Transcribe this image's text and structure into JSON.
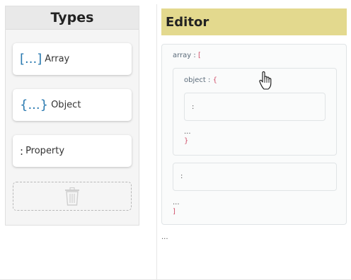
{
  "types_panel": {
    "title": "Types",
    "items": [
      {
        "symbol": "[...]",
        "label": "Array"
      },
      {
        "symbol": "{...}",
        "label": "Object"
      },
      {
        "symbol": ":",
        "label": "Property"
      }
    ],
    "trash_icon": "trash-icon"
  },
  "editor": {
    "title": "Editor",
    "array_node": {
      "key": "array",
      "sep": " : ",
      "open": "[",
      "close": "]",
      "ellipsis": "..."
    },
    "object_node": {
      "key": "object",
      "sep": " : ",
      "open": "{",
      "close": "}",
      "ellipsis": "..."
    },
    "inner_property": {
      "text": ":"
    },
    "array_property": {
      "text": ":"
    },
    "root_ellipsis": "..."
  },
  "colors": {
    "editor_header_bg": "#e3d98e",
    "bracket": "#d0506a",
    "symbol_blue": "#2a7ab0"
  }
}
